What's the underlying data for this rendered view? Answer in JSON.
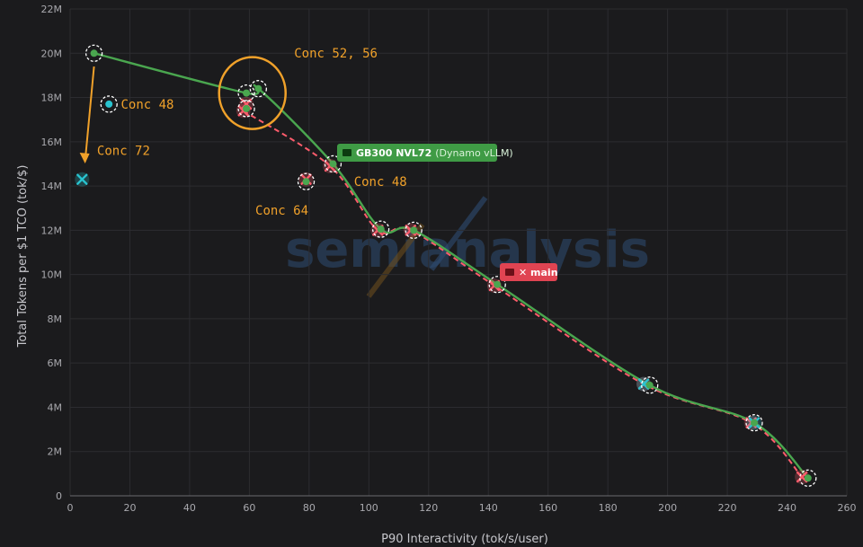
{
  "chart_data": {
    "type": "line",
    "title": "",
    "xlabel": "P90 Interactivity (tok/s/user)",
    "ylabel": "Total Tokens per $1 TCO (tok/$)",
    "xlim": [
      0,
      260
    ],
    "ylim": [
      0,
      22000000
    ],
    "x_ticks": [
      "0",
      "20",
      "40",
      "60",
      "80",
      "100",
      "120",
      "140",
      "160",
      "180",
      "200",
      "220",
      "240",
      "260"
    ],
    "y_ticks": [
      "0",
      "2M",
      "4M",
      "6M",
      "8M",
      "10M",
      "12M",
      "14M",
      "16M",
      "18M",
      "20M",
      "22M"
    ],
    "grid": true,
    "watermark": "semianalysis",
    "series": [
      {
        "name": "GB300 NVL72 (Dynamo vLLM)",
        "label_main": "GB300 NVL72",
        "label_sub": "(Dynamo vLLM)",
        "color": "#4aa64f",
        "style": "solid",
        "x": [
          8,
          59,
          63,
          88,
          104,
          115,
          143,
          194,
          229,
          247
        ],
        "y": [
          20000000,
          18200000,
          18400000,
          15000000,
          12050000,
          12000000,
          9550000,
          5000000,
          3300000,
          800000
        ],
        "extra_points": [
          {
            "x": 79,
            "y": 14200000
          },
          {
            "x": 59,
            "y": 17500000
          }
        ]
      },
      {
        "name": "main",
        "label_main": "main",
        "color": "#ff5c6c",
        "style": "dashed",
        "x": [
          58,
          87,
          103,
          114,
          142,
          192,
          228,
          245
        ],
        "y": [
          17400000,
          14900000,
          12000000,
          12000000,
          9500000,
          5050000,
          3300000,
          850000
        ],
        "extra_points": [
          {
            "x": 79,
            "y": 14300000
          },
          {
            "x": 59,
            "y": 17700000
          }
        ]
      }
    ],
    "outlier_points": [
      {
        "x": 4,
        "y": 14300000,
        "marker": "x",
        "color": "#29c4d0"
      },
      {
        "x": 13,
        "y": 17700000,
        "marker": "dot",
        "color": "#29c4d0"
      },
      {
        "x": 192,
        "y": 5050000,
        "marker": "x",
        "color": "#29c4d0"
      },
      {
        "x": 229,
        "y": 3300000,
        "marker": "x",
        "color": "#29c4d0"
      }
    ],
    "annotations": [
      {
        "text": "Conc 52, 56",
        "x": 75,
        "y": 19800000
      },
      {
        "text": "Conc 48",
        "x": 17,
        "y": 17500000
      },
      {
        "text": "Conc 72",
        "x": 9,
        "y": 15400000
      },
      {
        "text": "Conc 48",
        "x": 95,
        "y": 14000000
      },
      {
        "text": "Conc 64",
        "x": 62,
        "y": 12700000
      }
    ],
    "arrow": {
      "from": {
        "x": 8,
        "y": 19400000
      },
      "to": {
        "x": 5,
        "y": 15100000
      },
      "color": "#f0a12a"
    },
    "highlight_circle": {
      "cx": 61,
      "cy": 18200000,
      "color": "#f0a12a"
    }
  }
}
